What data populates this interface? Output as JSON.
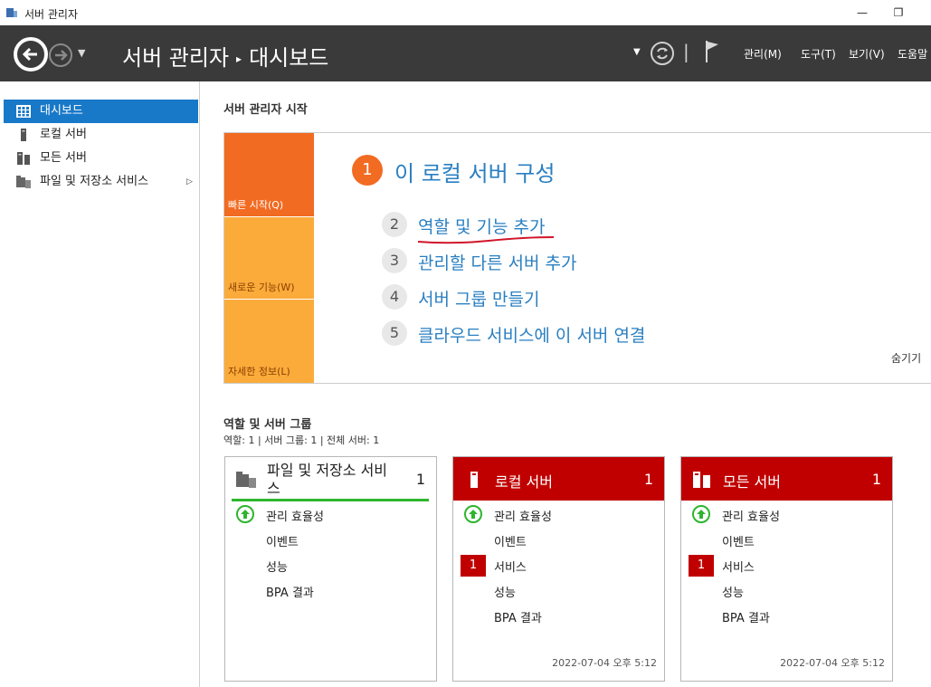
{
  "window": {
    "title": "서버 관리자",
    "minimize_glyph": "—",
    "restore_glyph": "❐"
  },
  "header": {
    "breadcrumb_root": "서버 관리자",
    "breadcrumb_separator": "▸",
    "breadcrumb_current": "대시보드",
    "menu": [
      "관리(M)",
      "도구(T)",
      "보기(V)",
      "도움말"
    ]
  },
  "sidebar": {
    "items": [
      {
        "label": "대시보드",
        "icon": "dashboard-icon",
        "selected": true
      },
      {
        "label": "로컬 서버",
        "icon": "server-icon"
      },
      {
        "label": "모든 서버",
        "icon": "servers-icon"
      },
      {
        "label": "파일 및 저장소 서비스",
        "icon": "folder-icon",
        "expand_arrow": "▷"
      }
    ]
  },
  "welcome": {
    "title": "서버 관리자 시작",
    "tiles": [
      "빠른 시작(Q)",
      "새로운 기능(W)",
      "자세한 정보(L)"
    ],
    "main_step": {
      "number": "1",
      "label": "이 로컬 서버 구성"
    },
    "steps": [
      {
        "number": "2",
        "label": "역할 및 기능 추가"
      },
      {
        "number": "3",
        "label": "관리할 다른 서버 추가"
      },
      {
        "number": "4",
        "label": "서버 그룹 만들기"
      },
      {
        "number": "5",
        "label": "클라우드 서비스에 이 서버 연결"
      }
    ],
    "hide_label": "숨기기"
  },
  "groups": {
    "title": "역할 및 서버 그룹",
    "counts": "역할: 1   |   서버 그룹: 1   |   전체 서버: 1",
    "cards": [
      {
        "name_line1": "파일 및 저장소 서비",
        "name_line2": "스",
        "count": "1",
        "rows": [
          "관리 효율성",
          "이벤트",
          "성능",
          "BPA 결과"
        ]
      },
      {
        "name": "로컬 서버",
        "count": "1",
        "rows": [
          "관리 효율성",
          "이벤트",
          "서비스",
          "성능",
          "BPA 결과"
        ],
        "services_badge": "1",
        "timestamp": "2022-07-04 오후 5:12"
      },
      {
        "name": "모든 서버",
        "count": "1",
        "rows": [
          "관리 효율성",
          "이벤트",
          "서비스",
          "성능",
          "BPA 결과"
        ],
        "services_badge": "1",
        "timestamp": "2022-07-04 오후 5:12"
      }
    ]
  },
  "colors": {
    "header_bg": "#3a3a3a",
    "selected_nav": "#1979c9",
    "quickstart_orange": "#f26b22",
    "tile_amber": "#fbab3a",
    "link_blue": "#2a7fc1",
    "alert_red": "#c00000",
    "ok_green": "#2eb52e"
  }
}
